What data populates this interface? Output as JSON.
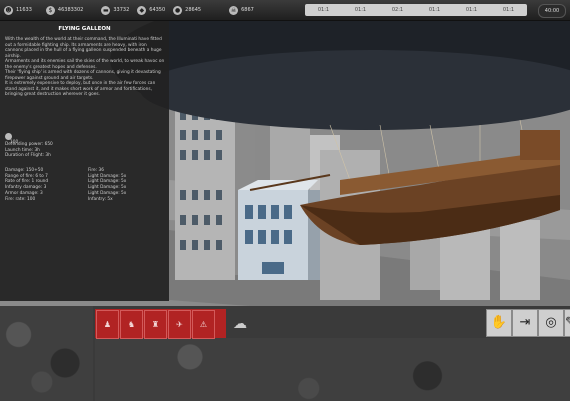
{
  "resources": [
    {
      "icon": "people-icon",
      "value": "11633"
    },
    {
      "icon": "money-icon",
      "value": "46383302"
    },
    {
      "icon": "gold-bars-icon",
      "value": "33732"
    },
    {
      "icon": "tank-icon",
      "value": "64350"
    },
    {
      "icon": "ammo-icon",
      "value": "28645"
    },
    {
      "icon": "skull-icon",
      "value": "6867"
    }
  ],
  "timers": [
    "01:1",
    "01:1",
    "02:1",
    "01:1",
    "01:1",
    "01:1"
  ],
  "corner_label": "40:00",
  "panel": {
    "title": "FLYING GALLEON",
    "description": "With the wealth of the world at their command, the Illuminati have fitted out a formidable fighting ship. Its armaments are heavy, with iron cannons placed in the hull of a flying galleon suspended beneath a huge airship.\nArmaments and its enemies sail the skies of the world, to wreak havoc on the enemy's greatest hopes and defenses.\nTheir 'flying ship' is armed with dozens of cannons, giving it devastating firepower against ground and air targets.\nIt is extremely expensive to deploy, but once in the air few forces can stand against it, and it makes short work of armor and fortifications, bringing great destruction wherever it goes.",
    "cost": "100",
    "info": "Defending power: 650\nLaunch time: 3h\nDuration of Flight: 3h",
    "stats_left": "Damage: 150+50\nRange of fire: 6 to 7\nRate of fire: 1 round\nInfantry damage: 3\nArmor damage: 3\nFire: rate: 100",
    "stats_right": "Fire: 36\nLight Damage: 5x\nLight Damage: 5x\nLight Damage: 5x\nLight Damage: 5x\nInfantry: 5x"
  },
  "toolbar": {
    "red_buttons": [
      "infantry-squad-icon",
      "soldiers-icon",
      "gunners-icon",
      "airstrike-icon",
      "warning-icon"
    ],
    "right_buttons": [
      "hand-icon",
      "exit-icon",
      "target-icon",
      "wrench-icon"
    ]
  }
}
